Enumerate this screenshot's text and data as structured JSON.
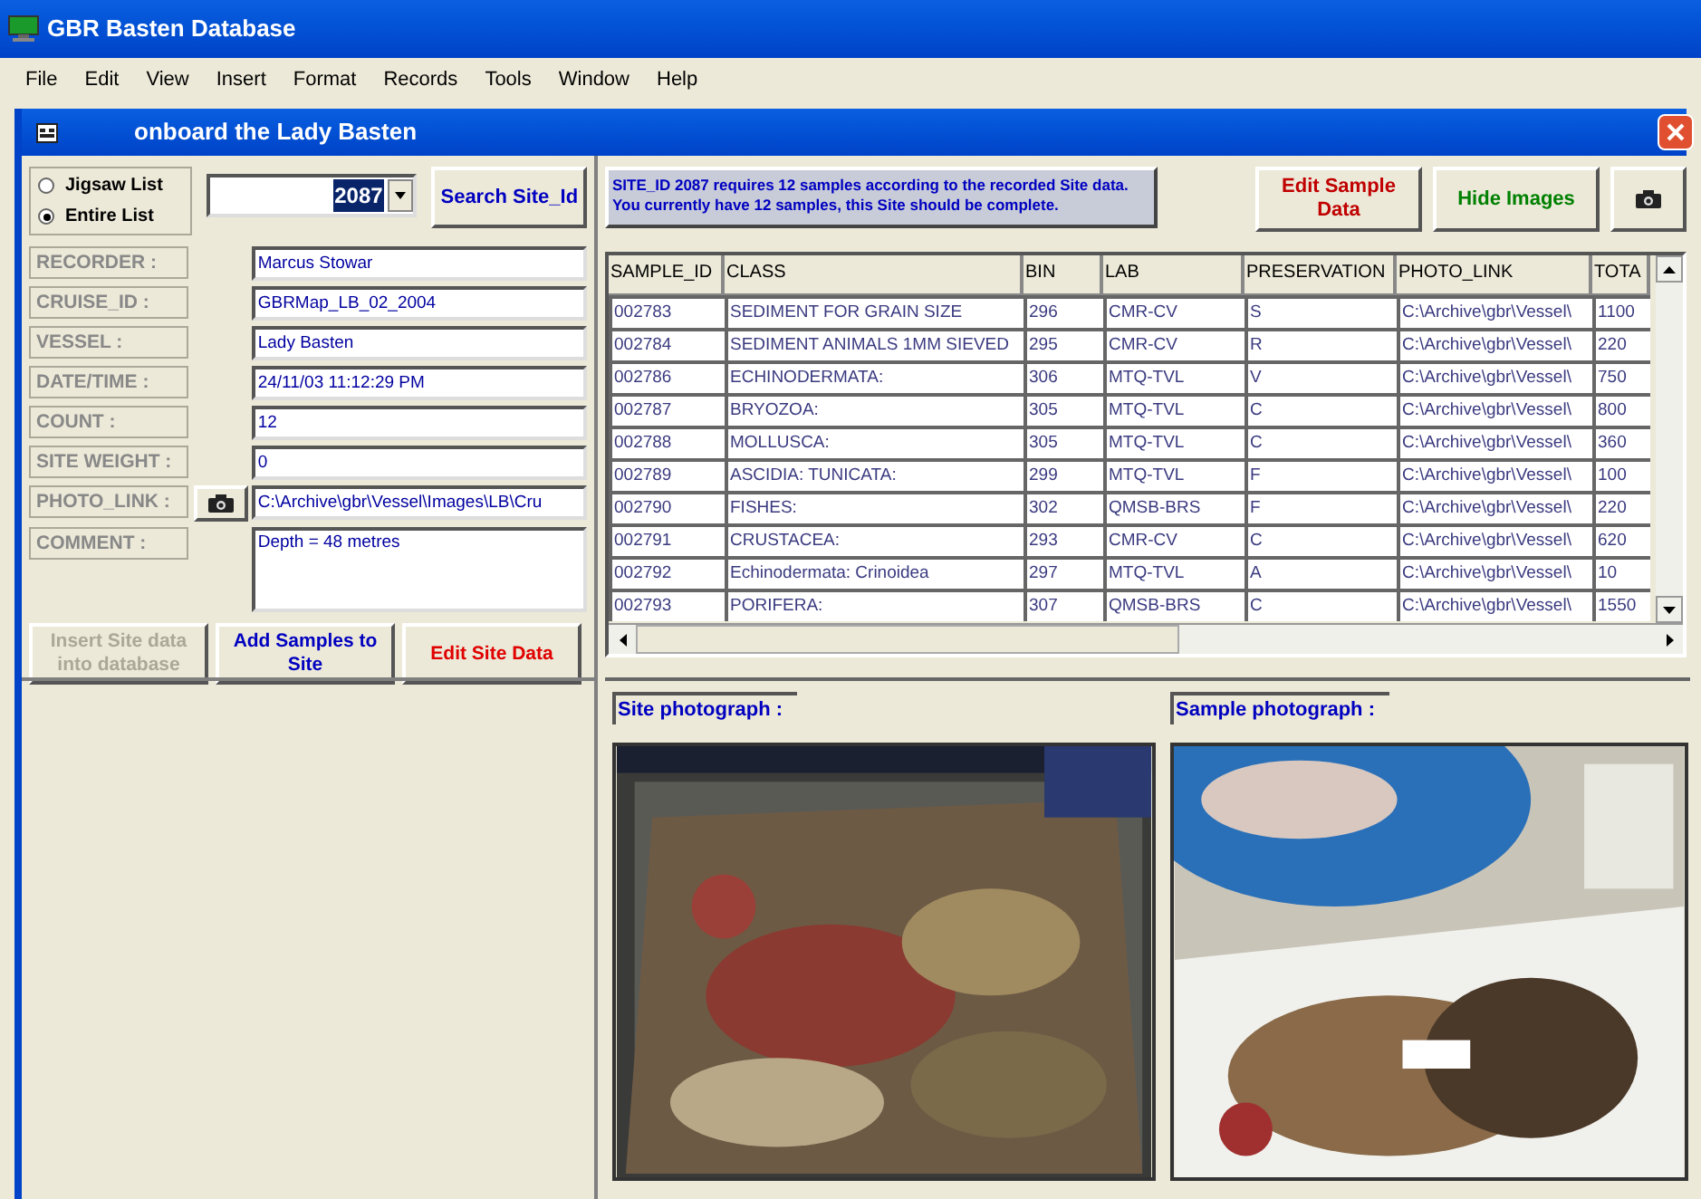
{
  "app_window": {
    "title": "GBR Basten Database"
  },
  "menu": [
    "File",
    "Edit",
    "View",
    "Insert",
    "Format",
    "Records",
    "Tools",
    "Window",
    "Help"
  ],
  "form_window": {
    "title": "onboard the Lady Basten"
  },
  "list_mode": [
    {
      "label": "Jigsaw List",
      "selected": false
    },
    {
      "label": "Entire List",
      "selected": true
    }
  ],
  "site_combo": {
    "value": "2087"
  },
  "search_button": "Search Site_Id",
  "fields": [
    {
      "label": "RECORDER :",
      "value": "Marcus Stowar"
    },
    {
      "label": "CRUISE_ID :",
      "value": "GBRMap_LB_02_2004"
    },
    {
      "label": "VESSEL :",
      "value": "Lady Basten"
    },
    {
      "label": "DATE/TIME :",
      "value": "24/11/03 11:12:29 PM"
    },
    {
      "label": "COUNT :",
      "value": "12"
    },
    {
      "label": "SITE WEIGHT :",
      "value": "0"
    },
    {
      "label": "PHOTO_LINK :",
      "value": "C:\\Archive\\gbr\\Vessel\\Images\\LB\\Cru",
      "camera": true
    },
    {
      "label": "COMMENT :",
      "value": "Depth = 48 metres",
      "multiline": true
    }
  ],
  "site_buttons": [
    {
      "label": "Insert Site data into database",
      "disabled": true
    },
    {
      "label": "Add Samples to Site",
      "disabled": false,
      "color": "#0000c0"
    },
    {
      "label": "Edit Site Data",
      "disabled": false,
      "color": "#e00000"
    }
  ],
  "message": "SITE_ID 2087 requires 12 samples according to the recorded Site data.\nYou currently have 12 samples, this Site should be complete.",
  "sample_buttons": [
    {
      "label": "Edit Sample Data",
      "color": "#c00000"
    },
    {
      "label": "Hide Images",
      "color": "#008000"
    }
  ],
  "table": {
    "columns": [
      "SAMPLE_ID",
      "CLASS",
      "BIN",
      "LAB",
      "PRESERVATION",
      "PHOTO_LINK",
      "TOTA"
    ],
    "rows": [
      [
        "002783",
        "SEDIMENT FOR GRAIN SIZE",
        "296",
        "CMR-CV",
        "S",
        "C:\\Archive\\gbr\\Vessel\\",
        "1100"
      ],
      [
        "002784",
        "SEDIMENT ANIMALS 1MM SIEVED",
        "295",
        "CMR-CV",
        "R",
        "C:\\Archive\\gbr\\Vessel\\",
        "220"
      ],
      [
        "002786",
        "ECHINODERMATA:",
        "306",
        "MTQ-TVL",
        "V",
        "C:\\Archive\\gbr\\Vessel\\",
        "750"
      ],
      [
        "002787",
        "BRYOZOA:",
        "305",
        "MTQ-TVL",
        "C",
        "C:\\Archive\\gbr\\Vessel\\",
        "800"
      ],
      [
        "002788",
        "MOLLUSCA:",
        "305",
        "MTQ-TVL",
        "C",
        "C:\\Archive\\gbr\\Vessel\\",
        "360"
      ],
      [
        "002789",
        "ASCIDIA: TUNICATA:",
        "299",
        "MTQ-TVL",
        "F",
        "C:\\Archive\\gbr\\Vessel\\",
        "100"
      ],
      [
        "002790",
        "FISHES:",
        "302",
        "QMSB-BRS",
        "F",
        "C:\\Archive\\gbr\\Vessel\\",
        "220"
      ],
      [
        "002791",
        "CRUSTACEA:",
        "293",
        "CMR-CV",
        "C",
        "C:\\Archive\\gbr\\Vessel\\",
        "620"
      ],
      [
        "002792",
        "Echinodermata: Crinoidea",
        "297",
        "MTQ-TVL",
        "A",
        "C:\\Archive\\gbr\\Vessel\\",
        "10"
      ],
      [
        "002793",
        "PORIFERA:",
        "307",
        "QMSB-BRS",
        "C",
        "C:\\Archive\\gbr\\Vessel\\",
        "1550"
      ]
    ]
  },
  "photos": [
    {
      "label": "Site photograph :",
      "kind": "picture"
    },
    {
      "label": "Sample photograph :",
      "kind": "picture"
    }
  ]
}
